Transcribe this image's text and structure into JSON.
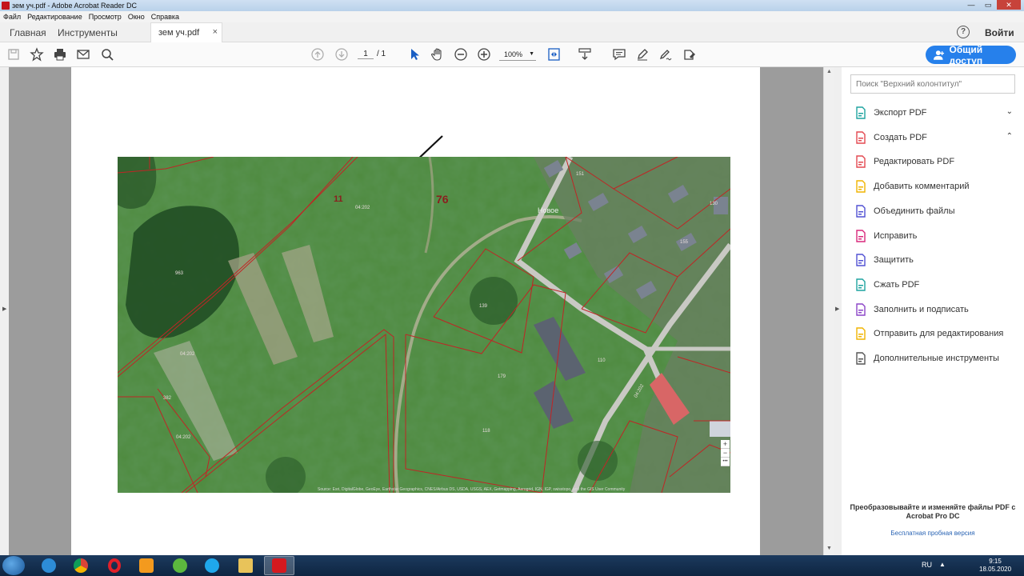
{
  "window": {
    "title": "зем уч.pdf - Adobe Acrobat Reader DC",
    "close_glyph": "✕"
  },
  "menu": [
    "Файл",
    "Редактирование",
    "Просмотр",
    "Окно",
    "Справка"
  ],
  "tabs": {
    "home": "Главная",
    "tools": "Инструменты",
    "document": "зем уч.pdf",
    "close_glyph": "×"
  },
  "header": {
    "help": "?",
    "sign_in": "Войти"
  },
  "toolbar": {
    "page_current": "1",
    "page_total": "/ 1",
    "zoom": "100%",
    "share": "Общий доступ"
  },
  "map": {
    "labels": {
      "l11": "11",
      "l76": "76",
      "novoe": "Новое",
      "n1": "04:202",
      "n2": "04:202",
      "n3": "04:202",
      "n4": "04:202",
      "n_963": "963",
      "n_151": "151",
      "n_130": "130",
      "n_139": "139",
      "n_179": "179",
      "n_110": "110",
      "n_118": "118",
      "n_155": "155",
      "n_382": "382"
    },
    "attribution": "Source: Esri, DigitalGlobe, GeoEye, Earthstar Geographics, CNES/Airbus DS, USDA, USGS, AEX, Getmapping, Aerogrid, IGN, IGP, swisstopo, and the GIS User Community",
    "zoom_in": "+",
    "zoom_out": "−",
    "more": "•••"
  },
  "right_panel": {
    "search_placeholder": "Поиск \"Верхний колонтитул\"",
    "tools": [
      {
        "label": "Экспорт PDF",
        "color": "#1fa4a0",
        "chev": "⌄"
      },
      {
        "label": "Создать PDF",
        "color": "#e34850",
        "chev": "⌃"
      },
      {
        "label": "Редактировать PDF",
        "color": "#e34850"
      },
      {
        "label": "Добавить комментарий",
        "color": "#f0b400"
      },
      {
        "label": "Объединить файлы",
        "color": "#5151d3"
      },
      {
        "label": "Исправить",
        "color": "#d9287b"
      },
      {
        "label": "Защитить",
        "color": "#5151d3"
      },
      {
        "label": "Сжать PDF",
        "color": "#1fa4a0"
      },
      {
        "label": "Заполнить и подписать",
        "color": "#8b45c7"
      },
      {
        "label": "Отправить для редактирования",
        "color": "#f0b400"
      },
      {
        "label": "Дополнительные инструменты",
        "color": "#555555"
      }
    ],
    "promo": "Преобразовывайте и изменяйте файлы PDF с Acrobat Pro DC",
    "trial": "Бесплатная пробная версия"
  },
  "taskbar": {
    "lang": "RU",
    "tray_up": "▲",
    "time": "9:15",
    "date": "18.05.2020"
  }
}
